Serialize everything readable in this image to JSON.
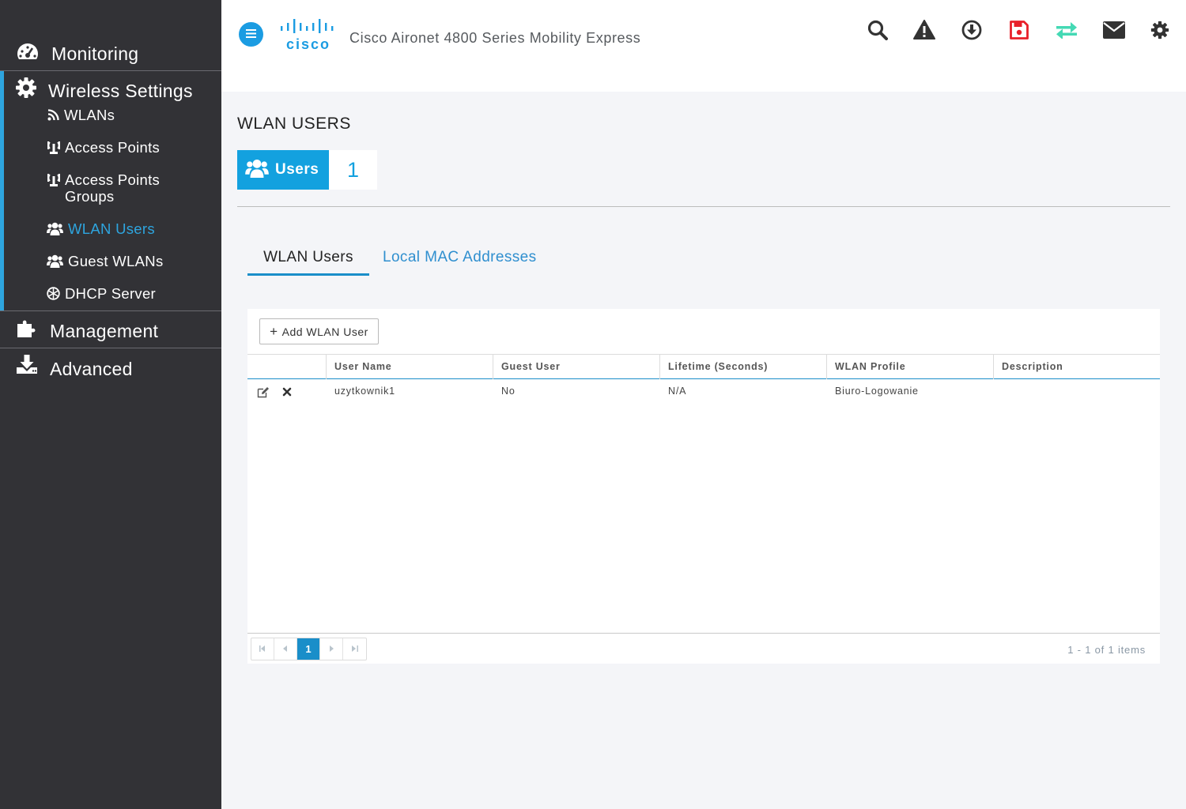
{
  "header": {
    "logo_text": "cisco",
    "product_title": "Cisco Aironet 4800 Series Mobility Express",
    "icons": [
      "search-icon",
      "alert-icon",
      "download-icon",
      "save-icon",
      "transfer-icon",
      "mail-icon",
      "gear-icon"
    ],
    "save_color": "#e8202a",
    "transfer_color": "#44d9b4"
  },
  "sidebar": {
    "items": [
      {
        "label": "Monitoring",
        "icon": "dashboard-icon"
      },
      {
        "label": "Wireless Settings",
        "icon": "gear-icon"
      },
      {
        "label": "Management",
        "icon": "puzzle-icon"
      },
      {
        "label": "Advanced",
        "icon": "download-tray-icon"
      }
    ],
    "wireless_subitems": [
      {
        "label": "WLANs",
        "icon": "rss-icon"
      },
      {
        "label": "Access Points",
        "icon": "access-point-icon"
      },
      {
        "label": "Access Points",
        "label2": "Groups",
        "icon": "access-point-icon"
      },
      {
        "label": "WLAN Users",
        "icon": "users-icon",
        "active": true
      },
      {
        "label": "Guest WLANs",
        "icon": "users-icon"
      },
      {
        "label": "DHCP Server",
        "icon": "dhcp-icon"
      }
    ],
    "accent_color": "#2ea5df"
  },
  "main": {
    "page_title": "WLAN USERS",
    "tile": {
      "label": "Users",
      "count": "1"
    },
    "tabs": [
      {
        "label": "WLAN Users",
        "active": true
      },
      {
        "label": "Local MAC Addresses",
        "active": false
      }
    ],
    "add_button_label": "Add WLAN User",
    "columns": [
      "User Name",
      "Guest User",
      "Lifetime (Seconds)",
      "WLAN Profile",
      "Description"
    ],
    "rows": [
      {
        "user_name": "uzytkownik1",
        "guest_user": "No",
        "lifetime": "N/A",
        "wlan_profile": "Biuro-Logowanie",
        "description": ""
      }
    ],
    "pager": {
      "current_page": "1",
      "info": "1 - 1 of 1 items"
    }
  }
}
